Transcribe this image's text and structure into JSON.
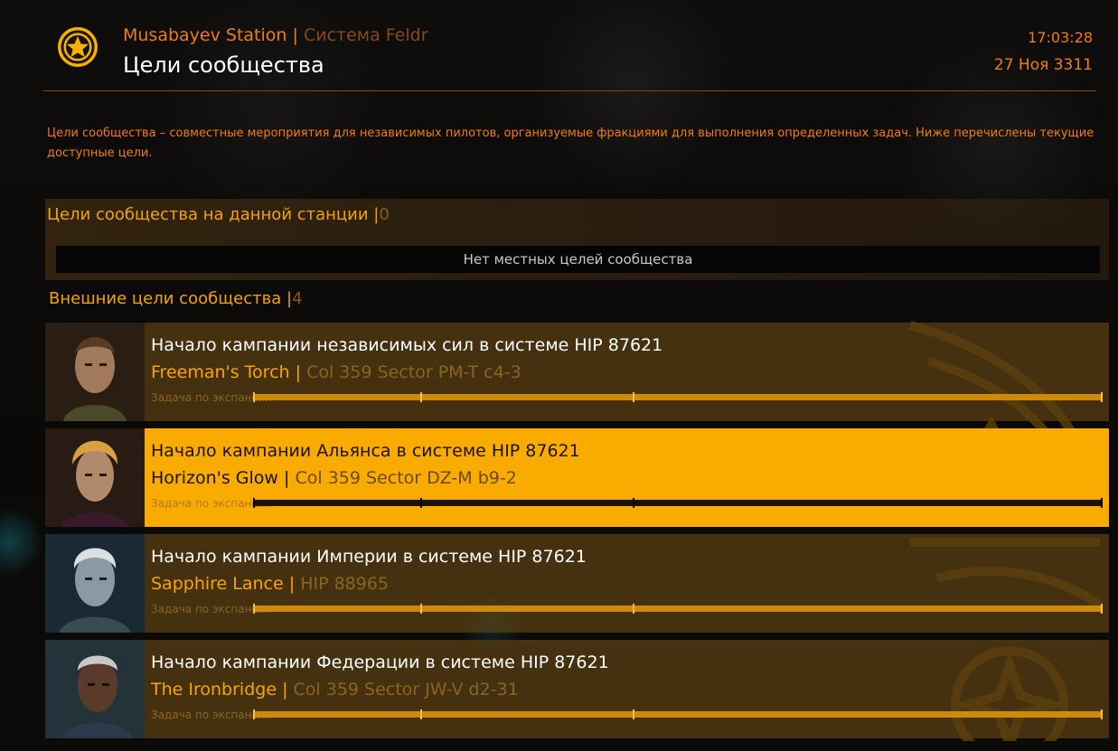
{
  "header": {
    "station_name": "Musabayev Station",
    "separator": "|",
    "system_name": "Система Feldr",
    "title": "Цели сообщества",
    "time": "17:03:28",
    "date": "27 Ноя 3311",
    "logo_icon": "star-emblem-icon"
  },
  "description": "Цели сообщества – совместные мероприятия для независимых пилотов, организуемые фракциями для выполнения определенных задач. Ниже перечислены текущие доступные цели.",
  "local_section": {
    "title": "Цели сообщества на данной станции",
    "separator": "|",
    "count": "0",
    "empty_message": "Нет местных целей сообщества"
  },
  "external_section": {
    "title": "Внешние цели сообщества",
    "separator": "|",
    "count": "4"
  },
  "goals": [
    {
      "title": "Начало кампании независимых сил в системе HIP 87621",
      "faction": "Freeman's Torch",
      "separator": "|",
      "system": "Col 359 Sector PM-T c4-3",
      "task_label": "Задача по экспансии",
      "selected": false
    },
    {
      "title": "Начало кампании Альянса в системе HIP 87621",
      "faction": "Horizon's Glow",
      "separator": "|",
      "system": "Col 359 Sector DZ-M b9-2",
      "task_label": "Задача по экспансии",
      "selected": true
    },
    {
      "title": "Начало кампании Империи в системе HIP 87621",
      "faction": "Sapphire Lance",
      "separator": "|",
      "system": "HIP 88965",
      "task_label": "Задача по экспансии",
      "selected": false
    },
    {
      "title": "Начало кампании Федерации в системе HIP 87621",
      "faction": "The Ironbridge",
      "separator": "|",
      "system": "Col 359 Sector JW-V d2-31",
      "task_label": "Задача по экспансии",
      "selected": false
    }
  ],
  "colors": {
    "accent_orange": "#f27d0c",
    "accent_gold": "#f9ab00",
    "card_bg": "#5c4012"
  }
}
